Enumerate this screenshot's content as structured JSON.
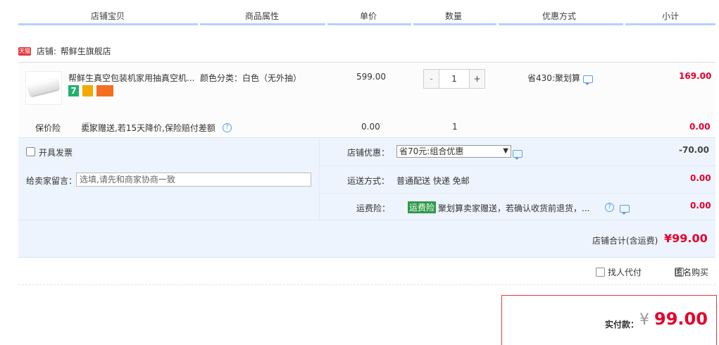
{
  "columns": [
    "店铺宝贝",
    "商品属性",
    "单价",
    "数量",
    "优惠方式",
    "小计"
  ],
  "shop": {
    "badge": "天猫",
    "prefix": "店铺:",
    "name": "帮鲜生旗舰店"
  },
  "item": {
    "title": "帮鲜生真空包装机家用抽真空机...",
    "attr": "颜色分类：白色（无外抽）",
    "price": "599.00",
    "qty_minus": "-",
    "qty_value": "1",
    "qty_plus": "+",
    "discount": "省430:聚划算",
    "subtotal": "169.00",
    "badge_seven": "7"
  },
  "insurance": {
    "label": "保价险",
    "desc": "卖家赠送,若15天降价,保险赔付差额",
    "price": "0.00",
    "qty": "1",
    "subtotal": "0.00"
  },
  "invoice": {
    "label": "开具发票"
  },
  "memo": {
    "label": "给卖家留言：",
    "placeholder": "选填,请先和商家协商一致"
  },
  "shop_promo": {
    "label": "店铺优惠：",
    "selected": "省70元:组合优惠",
    "amount": "-70.00"
  },
  "shipping": {
    "label": "运送方式：",
    "value": "普通配送 快递 免邮",
    "amount": "0.00"
  },
  "freight_ins": {
    "label": "运费险：",
    "tag": "运费险",
    "desc": "聚划算卖家赠送，若确认收货前退货，...",
    "amount": "0.00"
  },
  "shop_total": {
    "label": "店铺合计(含运费)",
    "value": "¥99.00"
  },
  "options": {
    "proxy_pay": "找人代付",
    "anonymous": "匿名购买"
  },
  "payment": {
    "label": "实付款：",
    "currency": "¥",
    "value": "99.00"
  },
  "colors": {
    "accent_red": "#e4002b",
    "header_line": "#b2d1ff",
    "panel_bg": "#eef4fd"
  }
}
